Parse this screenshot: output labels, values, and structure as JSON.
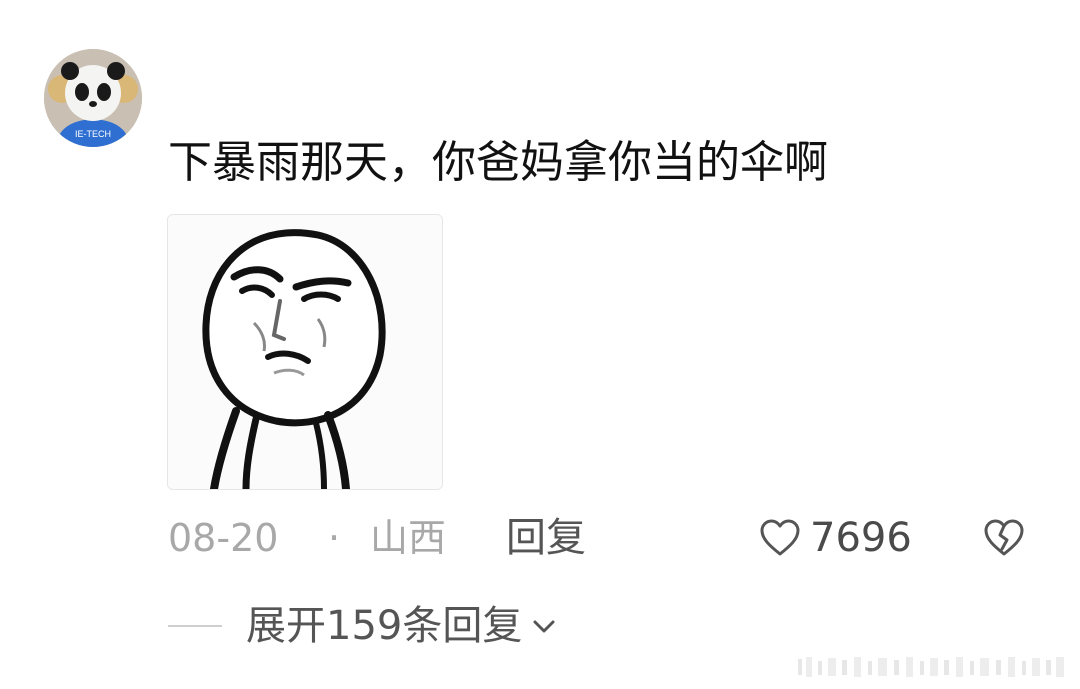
{
  "comment": {
    "text": "下暴雨那天，你爸妈拿你当的伞啊",
    "date": "08-20",
    "separator": "·",
    "location": "山西",
    "reply_label": "回复",
    "like_count": "7696",
    "expand_replies_label": "展开159条回复"
  },
  "icons": {
    "like": "heart-outline-icon",
    "dislike": "broken-heart-icon",
    "expand": "chevron-down-icon"
  },
  "colors": {
    "text_primary": "#111111",
    "text_meta": "#a8a8a8",
    "text_action": "#555555"
  }
}
